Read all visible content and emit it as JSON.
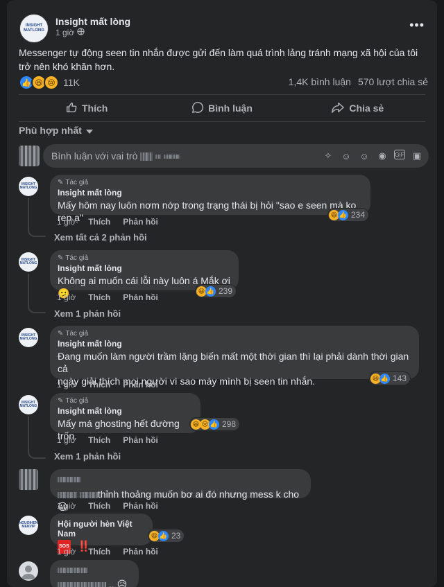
{
  "post": {
    "page_name": "Insight mất lòng",
    "logo_text_1": "INSIGHT",
    "logo_text_2": "MATLONG",
    "time": "1 giờ",
    "more": "•••",
    "text": "Messenger tự động seen tin nhắn được gửi đến làm quá trình lảng tránh mạng xã hội của tôi trở nên khó khăn hơn.",
    "reaction_count": "11K",
    "comments_count": "1,4K bình luận",
    "shares_count": "570 lượt chia sẻ"
  },
  "actions": {
    "like": "Thích",
    "comment": "Bình luận",
    "share": "Chia sẻ"
  },
  "sort_label": "Phù hợp nhất",
  "compose": {
    "placeholder": "Bình luận với vai trò"
  },
  "labels": {
    "author": "Tác giả",
    "like": "Thích",
    "reply": "Phản hồi"
  },
  "comments": [
    {
      "name": "Insight mất lòng",
      "text": "Mấy hôm nay luôn nơm nớp trong trạng thái bị hỏi \"sao e seen mà ko rep ạ\"",
      "time": "1 giờ",
      "reactions": "234",
      "view_replies": "Xem tất cả 2 phản hồi"
    },
    {
      "name": "Insight mất lòng",
      "text": "Không ai muốn cái lỗi này luôn á Mắk ơi 🫤",
      "time": "1 giờ",
      "reactions": "239",
      "view_replies": "Xem 1 phản hồi"
    },
    {
      "name": "Insight mất lòng",
      "text_1": "Đang muốn làm người trầm lặng biến mất một thời gian thì lại phải dành thời gian cả",
      "text_2": "ngày giải thích mọi người vì sao máy mình bị seen tin nhắn.",
      "time": "1 giờ",
      "reactions": "143"
    },
    {
      "name": "Insight mất lòng",
      "text": "Mấy má ghosting hết đường trốn.",
      "time": "1 giờ",
      "reactions": "298",
      "view_replies": "Xem 1 phản hồi"
    },
    {
      "text": "thỉnh thoảng muốn bơ ai đó nhưng mess k cho 😀",
      "time": "1 giờ"
    },
    {
      "name": "Hội người hèn Việt Nam",
      "sos": "SOS",
      "bang": "‼️",
      "logo_1": "NGUOIHEN",
      "logo_2": "MENVIP",
      "time": "1 giờ",
      "reactions": "23"
    },
    {
      "text": "..",
      "emoji": "😥"
    }
  ]
}
